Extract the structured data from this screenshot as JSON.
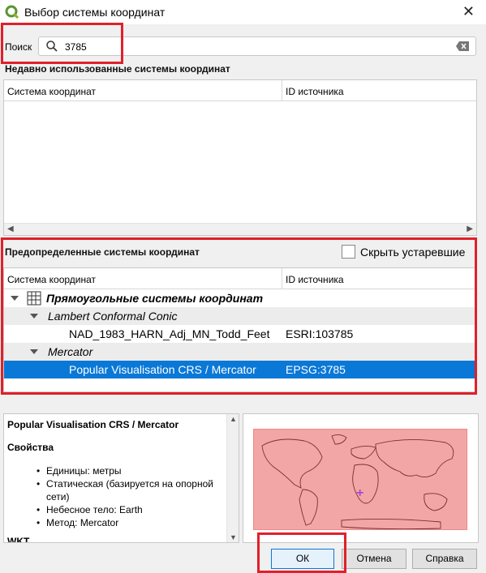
{
  "window": {
    "title": "Выбор системы координат",
    "app_icon": "qgis-icon",
    "close_icon": "close-icon"
  },
  "search": {
    "label": "Поиск",
    "value": "3785",
    "icon": "search-icon",
    "clear_icon": "clear-icon"
  },
  "recent": {
    "title": "Недавно использованные системы координат",
    "columns": [
      "Система координат",
      "ID источника"
    ]
  },
  "predefined": {
    "title": "Предопределенные системы координат",
    "hide_deprecated_label": "Скрыть устаревшие",
    "hide_deprecated_checked": false,
    "columns": [
      "Система координат",
      "ID источника"
    ],
    "rows": [
      {
        "level": 0,
        "label": "Прямоугольные системы координат",
        "id": ""
      },
      {
        "level": 1,
        "label": "Lambert Conformal Conic",
        "id": ""
      },
      {
        "level": 2,
        "label": "NAD_1983_HARN_Adj_MN_Todd_Feet",
        "id": "ESRI:103785"
      },
      {
        "level": 1,
        "label": "Mercator",
        "id": ""
      },
      {
        "level": 2,
        "label": "Popular Visualisation CRS / Mercator",
        "id": "EPSG:3785",
        "selected": true
      }
    ]
  },
  "info": {
    "title": "Popular Visualisation CRS / Mercator",
    "properties_heading": "Свойства",
    "properties": [
      "Единицы: метры",
      "Статическая (базируется на опорной сети)",
      "Небесное тело: Earth",
      "Метод: Mercator"
    ],
    "wkt_heading": "WKT"
  },
  "buttons": {
    "ok": "ОК",
    "cancel": "Отмена",
    "help": "Справка"
  },
  "colors": {
    "highlight": "#e0202a",
    "selection": "#0a78d7",
    "extent_fill": "#f3a6a6"
  }
}
